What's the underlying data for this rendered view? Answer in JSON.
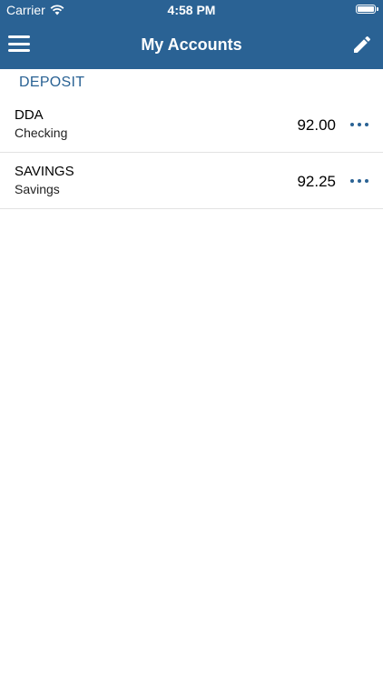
{
  "status_bar": {
    "carrier": "Carrier",
    "time": "4:58 PM",
    "icons": [
      "wifi-icon",
      "battery-icon"
    ]
  },
  "header": {
    "title": "My Accounts",
    "left_icon": "menu-icon",
    "right_icon": "edit-pencil-icon"
  },
  "section": {
    "title": "DEPOSIT"
  },
  "accounts": [
    {
      "name": "DDA",
      "type": "Checking",
      "balance": "92.00",
      "action_icon": "more-options-icon"
    },
    {
      "name": "SAVINGS",
      "type": "Savings",
      "balance": "92.25",
      "action_icon": "more-options-icon"
    }
  ],
  "colors": {
    "brand": "#2a6294",
    "background": "#ffffff",
    "divider": "#e2e2e2"
  }
}
